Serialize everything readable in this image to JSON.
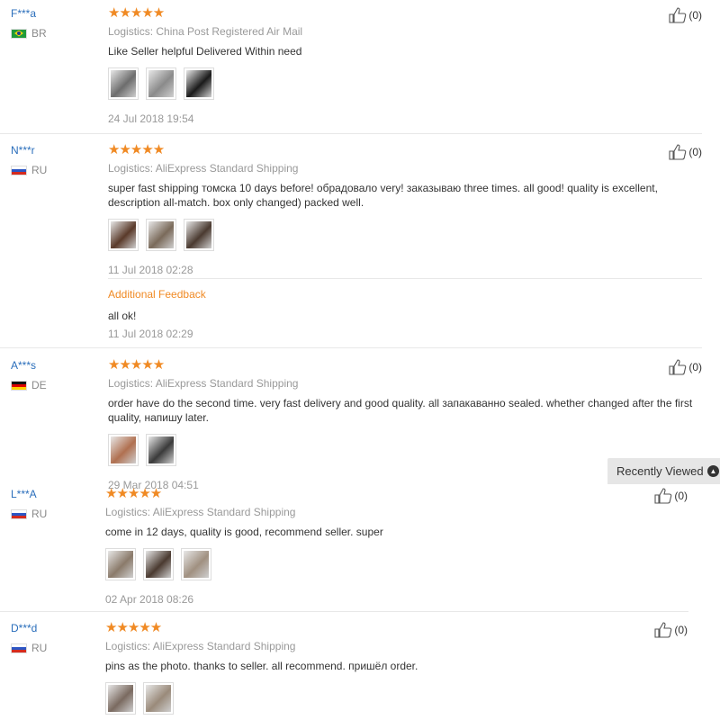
{
  "reviews": [
    {
      "buyer": "F***a",
      "country": "BR",
      "flag": "flag-br",
      "stars": "★★★★★",
      "logistics": "Logistics: China Post Registered Air Mail",
      "text": "Like Seller helpful Delivered Within need",
      "thumb_colors": [
        "#6d6d6d",
        "#8a8a8a",
        "#1a1a1a"
      ],
      "date": "24 Jul 2018 19:54",
      "helpful": "(0)"
    },
    {
      "buyer": "N***r",
      "country": "RU",
      "flag": "flag-ru",
      "stars": "★★★★★",
      "logistics": "Logistics: AliExpress Standard Shipping",
      "text": "super fast shipping томска 10 days before! обрадовало very! заказываю three times. all good! quality is excellent, description all-match. box only changed) packed well.",
      "thumb_colors": [
        "#5a3a2a",
        "#7a6a5a",
        "#4a3a30"
      ],
      "date": "11 Jul 2018 02:28",
      "additional_label": "Additional Feedback",
      "additional_text": "all ok!",
      "additional_date": "11 Jul 2018 02:29",
      "helpful": "(0)"
    },
    {
      "buyer": "A***s",
      "country": "DE",
      "flag": "flag-de",
      "stars": "★★★★★",
      "logistics": "Logistics: AliExpress Standard Shipping",
      "text": "order have do the second time. very fast delivery and good quality. all запакаванно sealed. whether changed after the first quality, напишу later.",
      "thumb_colors": [
        "#b07050",
        "#3a3a3a"
      ],
      "date": "29 Mar 2018 04:51",
      "helpful": "(0)"
    },
    {
      "buyer": "L***A",
      "country": "RU",
      "flag": "flag-ru",
      "stars": "★★★★★",
      "logistics": "Logistics: AliExpress Standard Shipping",
      "text": "come in 12 days, quality is good, recommend seller. super",
      "thumb_colors": [
        "#8a7a6a",
        "#4a3a30",
        "#a09080"
      ],
      "date": "02 Apr 2018 08:26",
      "helpful": "(0)"
    },
    {
      "buyer": "D***d",
      "country": "RU",
      "flag": "flag-ru",
      "stars": "★★★★★",
      "logistics": "Logistics: AliExpress Standard Shipping",
      "text": "pins as the photo. thanks to seller. all recommend. пришёл order.",
      "thumb_colors": [
        "#7a6a60",
        "#9a8a7a"
      ],
      "helpful": "(0)"
    }
  ],
  "recently_viewed": {
    "label": "Recently Viewed",
    "icon": "chevron-up-icon"
  }
}
